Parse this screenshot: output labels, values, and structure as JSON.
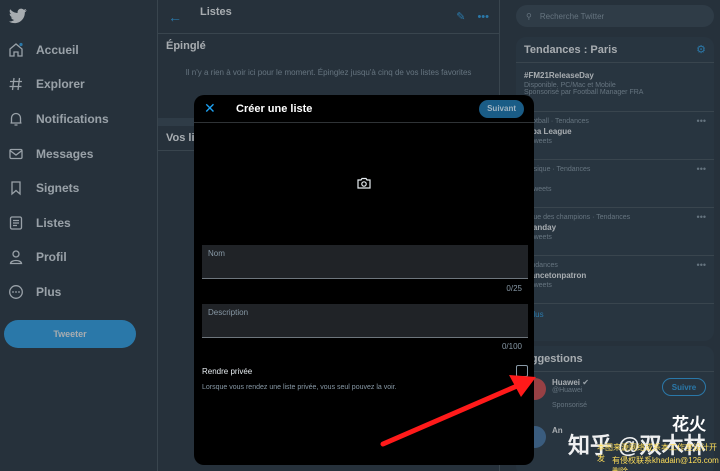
{
  "sidebar": {
    "items": [
      {
        "label": "Accueil",
        "icon": "home-icon"
      },
      {
        "label": "Explorer",
        "icon": "hashtag-icon"
      },
      {
        "label": "Notifications",
        "icon": "bell-icon"
      },
      {
        "label": "Messages",
        "icon": "envelope-icon"
      },
      {
        "label": "Signets",
        "icon": "bookmark-icon"
      },
      {
        "label": "Listes",
        "icon": "list-icon"
      },
      {
        "label": "Profil",
        "icon": "person-icon"
      },
      {
        "label": "Plus",
        "icon": "more-circle-icon"
      }
    ],
    "tweet_label": "Tweeter"
  },
  "main": {
    "title": "Listes",
    "pinned_title": "Épinglé",
    "pinned_empty": "Il n'y a rien à voir ici pour le moment. Épinglez jusqu'à cinq de vos listes favorites",
    "your_lists_title": "Vos li"
  },
  "right": {
    "search_placeholder": "Recherche Twitter",
    "trends_title": "Tendances : Paris",
    "trends": [
      {
        "context": "",
        "name": "#FM21ReleaseDay",
        "meta": "Disponible. PC/Mac et Mobile",
        "meta2": "Sponsorisé par Football Manager FRA"
      },
      {
        "context": "Football · Tendances",
        "name": "ropa League",
        "meta": "8 Tweets"
      },
      {
        "context": "Musique · Tendances",
        "name": "rti",
        "meta": "k Tweets"
      },
      {
        "context": "Ligue des champions · Tendances",
        "name": "ylianday",
        "meta": "8 Tweets"
      },
      {
        "context": "Tendances",
        "name": "alancetonpatron",
        "meta": "3 Tweets"
      }
    ],
    "show_more": "r plus",
    "suggestions_title": "uggestions",
    "suggestions": [
      {
        "name": "Huawei",
        "handle": "@Huawei",
        "promo": "Sponsorisé",
        "follow": "Suivre"
      },
      {
        "name": "An",
        "handle": "",
        "promo": "",
        "follow": ""
      }
    ]
  },
  "modal": {
    "title": "Créer une liste",
    "next_label": "Suivant",
    "name_label": "Nom",
    "name_value": "",
    "name_counter": "0/25",
    "desc_label": "Description",
    "desc_value": "",
    "desc_counter": "0/100",
    "private_title": "Rendre privée",
    "private_desc": "Lorsque vous rendez une liste privée, vous seul pouvez la voir.",
    "private_checked": false
  },
  "watermark": {
    "logo": "知乎 @双木林",
    "brand": "花火",
    "line1": "本图来源网络或系本工作室设计开发",
    "line2": "有侵权联系khadain@126.com删除"
  },
  "colors": {
    "background": "#15202b",
    "accent": "#1da1f2",
    "modal": "#000000",
    "annotation_arrow": "#ff1a1a"
  }
}
